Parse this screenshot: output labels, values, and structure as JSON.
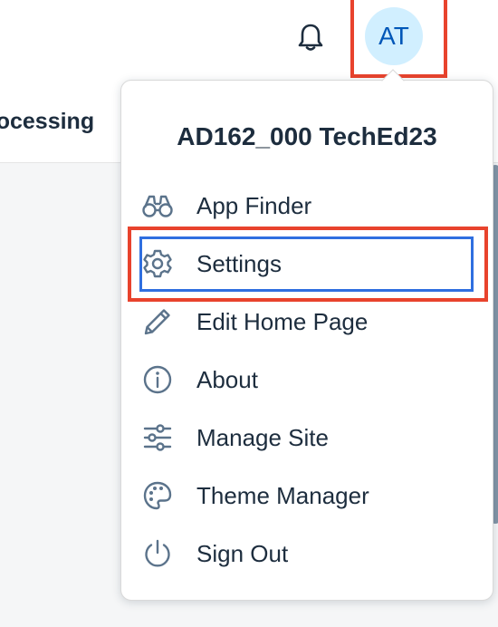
{
  "header": {
    "page_title": "rocessing",
    "avatar_initials": "AT"
  },
  "user_menu": {
    "user_name": "AD162_000 TechEd23",
    "items": [
      {
        "label": "App Finder",
        "icon": "binoculars-icon"
      },
      {
        "label": "Settings",
        "icon": "gear-icon"
      },
      {
        "label": "Edit Home Page",
        "icon": "pencil-icon"
      },
      {
        "label": "About",
        "icon": "info-icon"
      },
      {
        "label": "Manage Site",
        "icon": "sliders-icon"
      },
      {
        "label": "Theme Manager",
        "icon": "palette-icon"
      },
      {
        "label": "Sign Out",
        "icon": "power-icon"
      }
    ]
  },
  "colors": {
    "highlight_red": "#e8432d",
    "focus_blue": "#2f6fe0",
    "avatar_bg": "#d1efff",
    "avatar_text": "#0057b8",
    "icon_gray": "#5b738b"
  }
}
